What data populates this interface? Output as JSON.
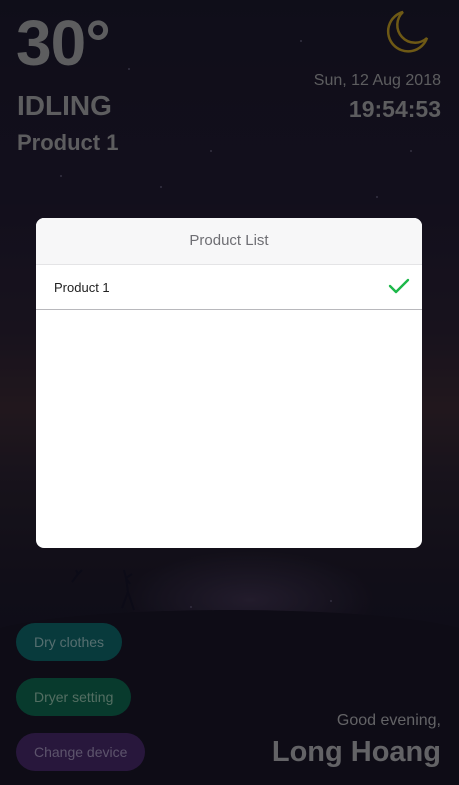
{
  "weather": {
    "temperature": "30°",
    "icon": "moon-icon",
    "moon_color": "#c9a227"
  },
  "dryer": {
    "status": "IDLING",
    "product": "Product 1"
  },
  "datetime": {
    "date": "Sun, 12 Aug 2018",
    "time": "19:54:53"
  },
  "actions": {
    "dry_clothes": "Dry clothes",
    "dryer_setting": "Dryer setting",
    "change_device": "Change device"
  },
  "greeting": {
    "salutation": "Good evening,",
    "name": "Long Hoang"
  },
  "product_list_dialog": {
    "title": "Product List",
    "items": [
      {
        "label": "Product 1",
        "selected": true,
        "check_icon": "check-icon"
      }
    ],
    "check_color": "#1db84a"
  }
}
